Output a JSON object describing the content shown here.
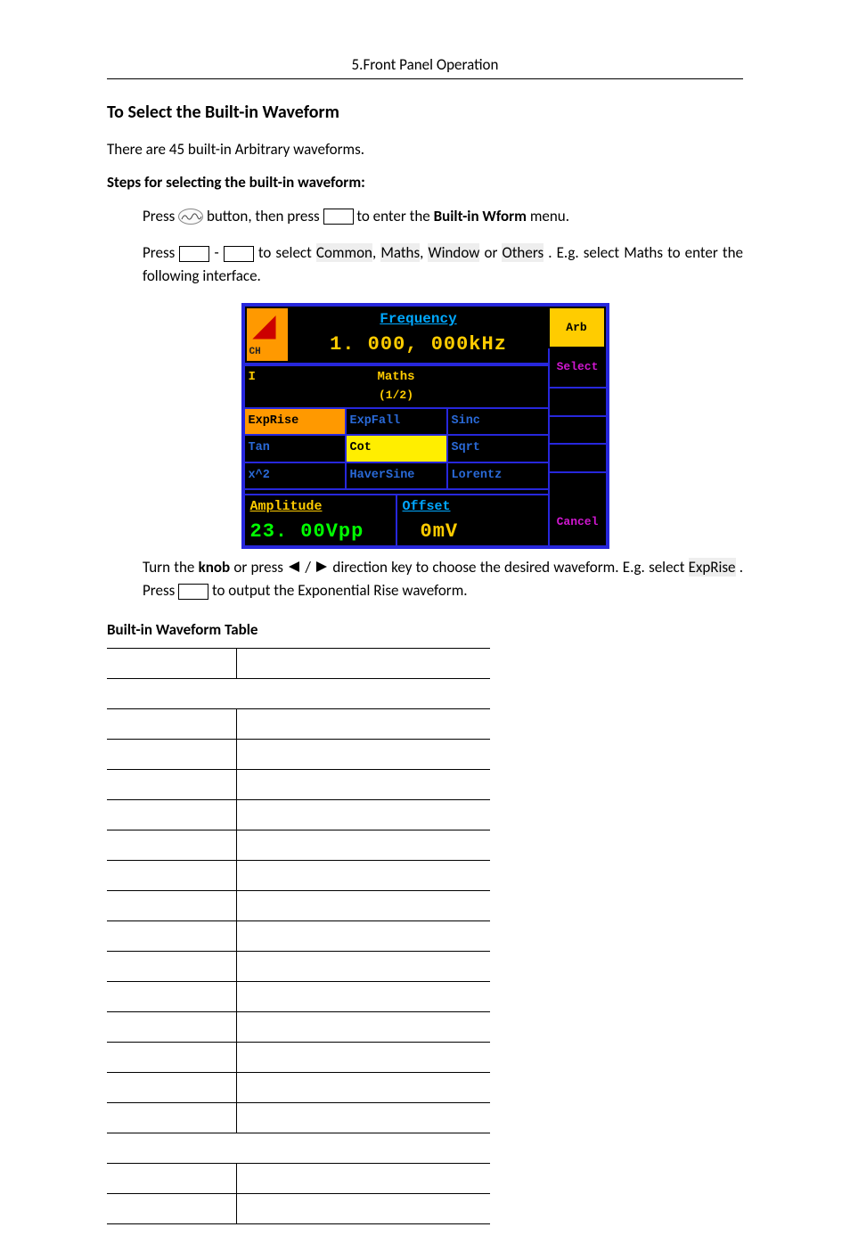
{
  "header": "5.Front Panel Operation",
  "h2": "To Select the Built-in Waveform",
  "intro": "There are 45 built-in Arbitrary waveforms.",
  "steps_title": "Steps for selecting the built-in waveform:",
  "step1": {
    "a": "Press ",
    "b": " button, then press ",
    "c": " to enter the ",
    "d": "Built-in Wform",
    "e": " menu."
  },
  "step2": {
    "a": "Press ",
    "b": " - ",
    "c": " to select ",
    "hl": [
      "Common",
      "Maths",
      "Window",
      "Others"
    ],
    "mid": ", ",
    "or": " or ",
    "d": ". E.g. select Maths to enter the following interface."
  },
  "step3": {
    "a": "Turn the ",
    "knob": "knob",
    "b": " or press ",
    "c": " direction key to choose the desired waveform. E.g. select ",
    "hl": "ExpRise",
    "d": ". Press ",
    "e": " to output the Exponential Rise waveform."
  },
  "table_title": "Built-in Waveform Table",
  "panel": {
    "ch": "CH",
    "freq_label": "Frequency",
    "freq_value": "1. 000, 000kHz",
    "side": {
      "arb": "Arb",
      "select": "Select",
      "cancel": "Cancel"
    },
    "maths_label": "Maths",
    "maths_page": "(1/2)",
    "rows": [
      [
        "ExpRise",
        "ExpFall",
        "Sinc"
      ],
      [
        "Tan",
        "Cot",
        "Sqrt"
      ],
      [
        "x^2",
        "HaverSine",
        "Lorentz"
      ]
    ],
    "amp_label": "Amplitude",
    "amp_value": "23. 00Vpp",
    "off_label": "Offset",
    "off_value": "0mV",
    "I": "I"
  },
  "slash": "/"
}
